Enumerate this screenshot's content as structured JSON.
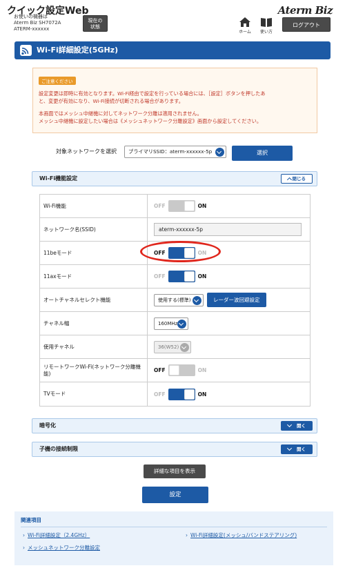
{
  "header": {
    "app_title": "クイック設定Web",
    "device_lines": [
      "お使いの機器は",
      "Aterm Biz SH7072A",
      "ATERM-xxxxxx"
    ],
    "status_button": [
      "現在の",
      "状態"
    ],
    "brand": "Aterm Biz",
    "home_label": "ホーム",
    "howto_label": "使い方",
    "logout_label": "ログアウト"
  },
  "page": {
    "title": "Wi-Fi詳細設定(5GHz)"
  },
  "notice": {
    "tag": "ご注意ください",
    "line1": "設定変更は即時に有効となります。Wi-Fi経由で設定を行っている場合には、［設定］ボタンを押したあ",
    "line2": "と、変更が有効になり、Wi-Fi接続が切断される場合があります。",
    "line3": "本画面ではメッシュ中継機に対してネットワーク分離は適用されません。",
    "line4": "メッシュ中継機に設定したい場合は《メッシュネットワーク分離設定》画面から設定してください。"
  },
  "network_select": {
    "label": "対象ネットワークを選択",
    "value": "プライマリSSID：aterm-xxxxxx-5p",
    "button": "選択"
  },
  "sections": {
    "wifi_function": {
      "title": "Wi-Fi機能設定",
      "toggle": "閉じる"
    },
    "encryption": {
      "title": "暗号化",
      "toggle": "開く"
    },
    "access_limit": {
      "title": "子機の接続制限",
      "toggle": "開く"
    }
  },
  "toggle_text": {
    "off": "OFF",
    "on": "ON"
  },
  "rows": {
    "wifi": {
      "label": "Wi-Fi機能"
    },
    "ssid": {
      "label": "ネットワーク名(SSID)",
      "value": "aterm-xxxxxx-5p"
    },
    "be11": {
      "label": "11beモード"
    },
    "ax11": {
      "label": "11axモード"
    },
    "auto_channel": {
      "label": "オートチャネルセレクト機能",
      "value": "使用する(標準)",
      "button": "レーダー波回避設定"
    },
    "bandwidth": {
      "label": "チャネル幅",
      "value": "160MHz"
    },
    "channel": {
      "label": "使用チャネル",
      "value": "36(W52)"
    },
    "remote": {
      "label": "リモートワークWi-Fi(ネットワーク分離機能)"
    },
    "tv": {
      "label": "TVモード"
    }
  },
  "actions": {
    "show_details": "詳細な項目を表示",
    "save": "設定"
  },
  "related": {
    "title": "関連項目",
    "link1": "Wi-Fi詳細設定（2.4GHz）",
    "link2": "Wi-Fi詳細設定(メッシュ/バンドステアリング)",
    "link3": "メッシュネットワーク分離設定"
  },
  "colors": {
    "primary": "#1d5aa5",
    "notice_text": "#c0392b",
    "highlight": "#e0261c",
    "dark_button": "#4a4a4a"
  }
}
